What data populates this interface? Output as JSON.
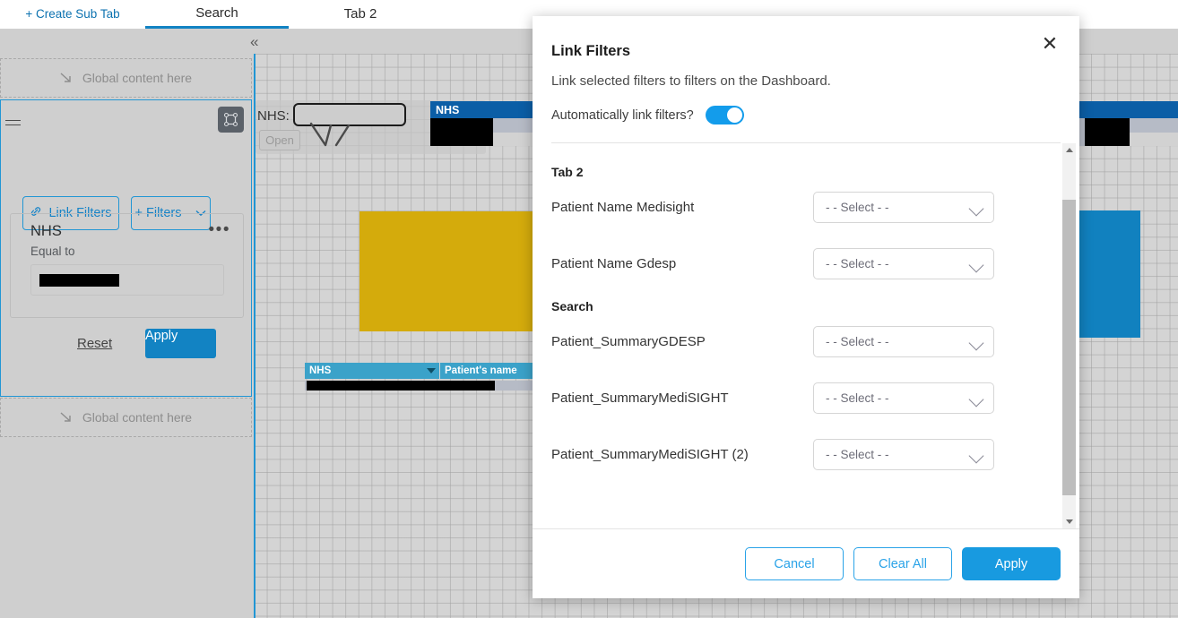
{
  "tabs": [
    {
      "label": "+ Create Sub Tab",
      "name": "tab-create-sub-tab",
      "active": false
    },
    {
      "label": "Search",
      "name": "tab-search",
      "active": true
    },
    {
      "label": "Tab 2",
      "name": "tab-tab-2",
      "active": false
    }
  ],
  "left_panel": {
    "global_drop_top": "Global content here",
    "global_drop_bottom": "Global content here",
    "link_filters_button": "Link Filters",
    "add_filters_button": "+ Filters",
    "filter_card": {
      "title": "NHS",
      "operator": "Equal to",
      "value": ""
    },
    "reset_link": "Reset",
    "apply_button": "Apply"
  },
  "canvas": {
    "nhs_widget_label": "NHS:",
    "nhs_open_button": "Open",
    "table_header_nhs": "NHS",
    "table2_col1": "NHS",
    "table2_col2": "Patient's name",
    "colors": {
      "yellow_block": "#d4ab0c",
      "blue_block": "#1181bf",
      "table_header_blue": "#0b5ea6",
      "table2_header_blue": "#3ba2c9"
    }
  },
  "modal": {
    "title": "Link Filters",
    "subtitle": "Link selected filters to filters on the Dashboard.",
    "auto_link_label": "Automatically link filters?",
    "auto_link_enabled": true,
    "select_placeholder": "- - Select - -",
    "groups": [
      {
        "name": "Tab 2",
        "rows": [
          {
            "label": "Patient Name Medisight",
            "value": "- - Select - -"
          },
          {
            "label": "Patient Name Gdesp",
            "value": "- - Select - -"
          }
        ]
      },
      {
        "name": "Search",
        "rows": [
          {
            "label": "Patient_SummaryGDESP",
            "value": "- - Select - -"
          },
          {
            "label": "Patient_SummaryMediSIGHT",
            "value": "- - Select - -"
          },
          {
            "label": "Patient_SummaryMediSIGHT (2)",
            "value": "- - Select - -"
          }
        ]
      }
    ],
    "footer": {
      "cancel": "Cancel",
      "clear_all": "Clear All",
      "apply": "Apply"
    }
  },
  "theme": {
    "accent_blue": "#1283c3",
    "toggle_blue": "#139ceb",
    "panel_grey": "#cfcfcf"
  }
}
